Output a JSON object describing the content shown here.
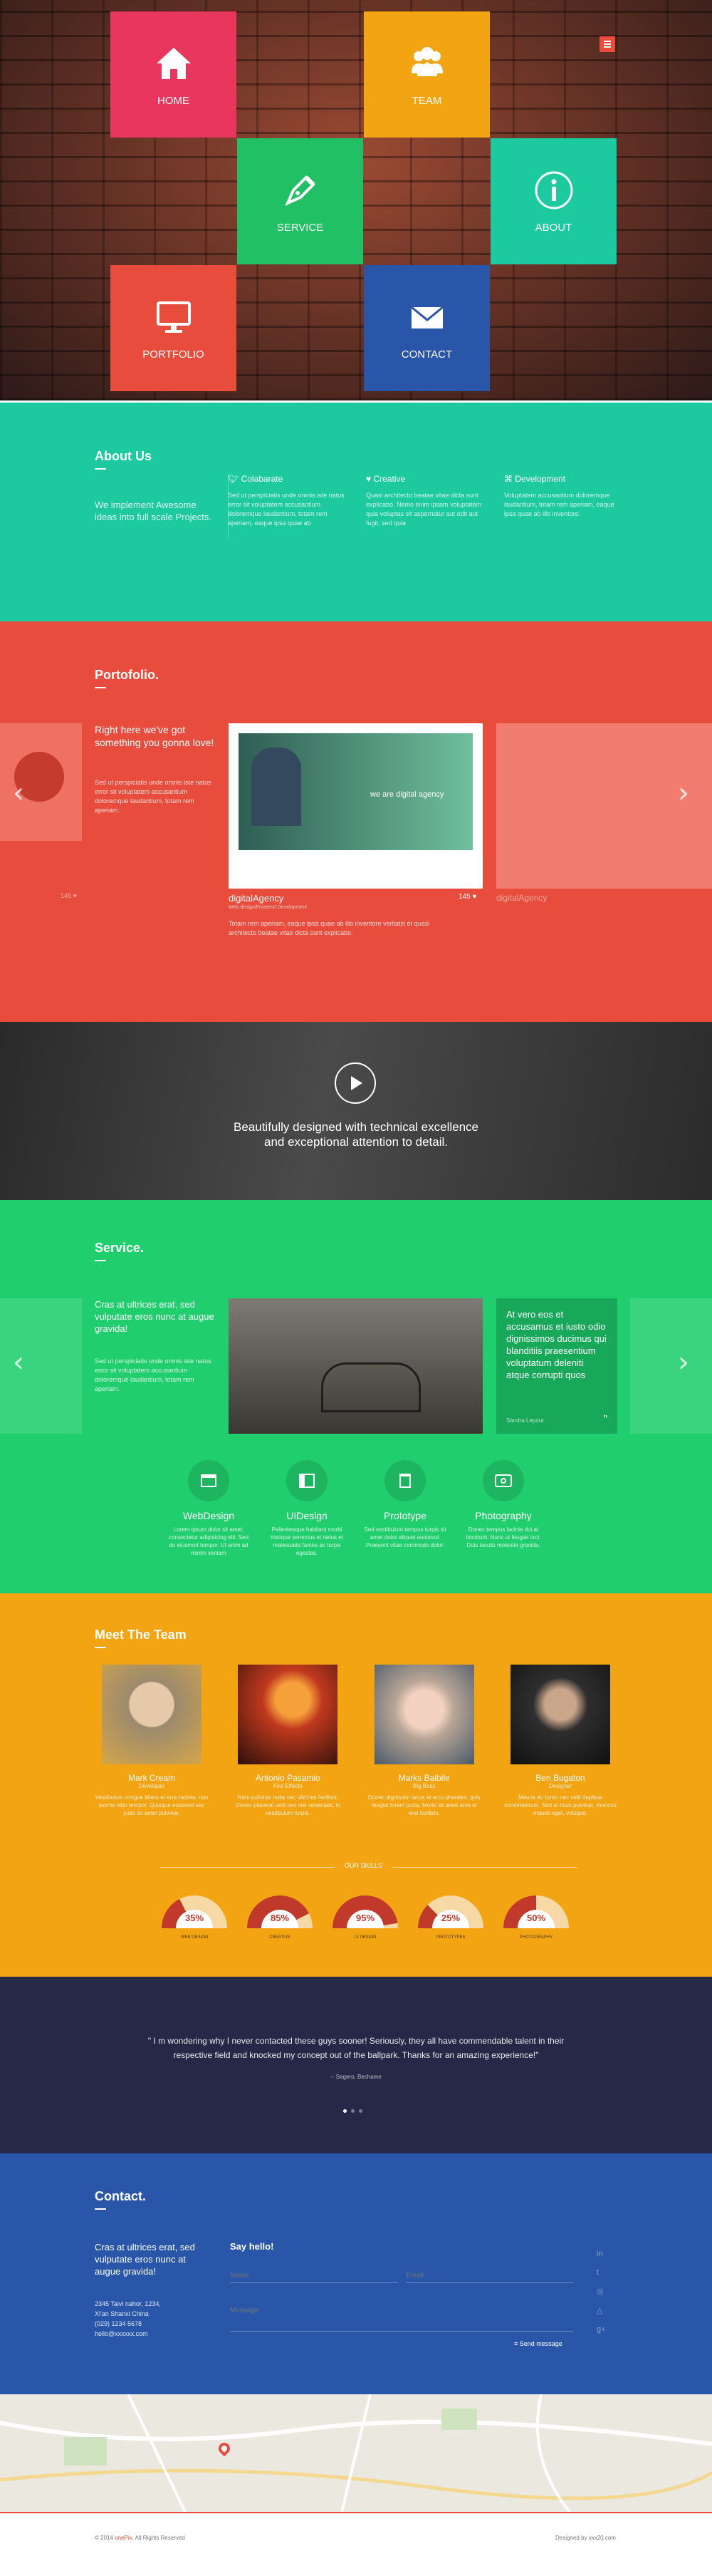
{
  "hero": {
    "tiles": [
      {
        "label": "HOME",
        "color": "#e8365c",
        "icon": "home-icon"
      },
      {
        "label": "TEAM",
        "color": "#f2a413",
        "icon": "team-icon"
      },
      {
        "label": "SERVICE",
        "color": "#21c064",
        "icon": "pen-icon"
      },
      {
        "label": "ABOUT",
        "color": "#1dcaa0",
        "icon": "info-icon"
      },
      {
        "label": "PORTFOLIO",
        "color": "#e74c3c",
        "icon": "monitor-icon"
      },
      {
        "label": "CONTACT",
        "color": "#2956a8",
        "icon": "mail-icon"
      }
    ]
  },
  "about": {
    "title": "About Us",
    "lead": "We implement Awesome ideas into full scale Projects.",
    "cols": [
      {
        "title": "Colabarate",
        "text": "Sed ut perspiciatis unde omnis iste natus error sit voluptatem accusantium doloremque laudantium, totam rem aperiam, eaque ipsa quae ab"
      },
      {
        "title": "Creative",
        "text": "Quasi architecto beatae vitae dicta sunt explicabo. Nemo enim ipsam voluptatem quia voluptas sit aspernatur aut odit aut fugit, sed quia"
      },
      {
        "title": "Development",
        "text": "Voluptatem accusantium doloremque laudantium, totam rem aperiam, eaque ipsa quae ab illo inventore."
      }
    ]
  },
  "portfolio": {
    "title": "Portofolio.",
    "intro": "Right here we've got something you gonna love!",
    "intro_text": "Sed ut perspiciatis unde omnis iste natus error sit voluptatem accusantium doloremque laudantium, totam rem aperiam.",
    "item": {
      "name": "digitalAgency",
      "category": "Web design/Frontend Development",
      "likes": "145",
      "desc": "Totam rem aperiam, eaque ipsa quae ab illo inventore veritatis et quasi architecto beatae vitae dicta sunt explicabo.",
      "screen_text": "we are digital agency"
    },
    "left_likes": "145",
    "right_name": "digitalAgency"
  },
  "video": {
    "line1": "Beautifully designed with technical excellence",
    "line2": "and exceptional attention to detail."
  },
  "service": {
    "title": "Service.",
    "intro": "Cras at ultrices erat, sed vulputate eros nunc at augue gravida!",
    "intro_text": "Sed ut perspiciatis unde omnis iste natus error sit voluptatem accusantium doloremque laudantium, totam rem aperiam.",
    "quote": "At vero eos et accusamus et iusto odio dignissimos ducimus qui blanditiis praesentium voluptatum deleniti atque corrupti quos",
    "quote_author": "Sandra Lepout",
    "items": [
      {
        "title": "WebDesign",
        "text": "Lorem ipsum dolor sit amet, consectetur adipisicing elit. Sed do eiusmod tempor. Ut enim ad minim veniam",
        "icon": "browser-icon"
      },
      {
        "title": "UIDesign",
        "text": "Pellentesque habitant morbi tristique senectus et netus et malesuada fames ac turpis egestas.",
        "icon": "layout-icon"
      },
      {
        "title": "Prototype",
        "text": "Sed vestibulum tempus turpis sit amet dolor aliquet euismod. Praesent vitae commodo dolor.",
        "icon": "trash-icon"
      },
      {
        "title": "Photography",
        "text": "Donec tempus lacinia dui at tincidunt. Nunc ut feugiat orci. Duis iaculis molestie gravida.",
        "icon": "camera-icon"
      }
    ]
  },
  "team": {
    "title": "Meet The Team",
    "skills_title": "OUR SKILLS",
    "members": [
      {
        "name": "Mark Cream",
        "role": "Developer",
        "bio": "Vestibulum congue libero et arcu lacinia, non lacinia nibh tempor. Quisque euismod nec justo sit amet pulvinar.",
        "photo": "#9c8a6e"
      },
      {
        "name": "Antonio Pasamio",
        "role": "Fire Effects",
        "bio": "Nam pulvinar nulla nec ultricies facilisis. Donec placerat velit nec nisi venenatis, in vestibulum turpis.",
        "photo": "#7a2b1d"
      },
      {
        "name": "Marks Balbile",
        "role": "Big Boss",
        "bio": "Donec dignissim lacus at arcu pharetra, quis feugiat lorem porta. Morbi sit amet ante id erat facilisis.",
        "photo": "#b8a596"
      },
      {
        "name": "Ben Bugaton",
        "role": "Designer",
        "bio": "Mauris eu tortor nec velit dapibus condimentum. Sed at risus pulvinar, rhoncus mauris eget, volutpat.",
        "photo": "#2e2e2e"
      }
    ],
    "skills": [
      {
        "label": "WEB DESIGN",
        "value": 35
      },
      {
        "label": "CREATIVE",
        "value": 85
      },
      {
        "label": "UI DESIGN",
        "value": 95
      },
      {
        "label": "PROTOTYPES",
        "value": 25
      },
      {
        "label": "PHOTOGRAPHY",
        "value": 50
      }
    ]
  },
  "testimonial": {
    "quote": "\" I m wondering why I never contacted these guys sooner! Seriously, they all have commendable talent in their respective field and knocked my concept out of the ballpark. Thanks for an amazing experience!\"",
    "author": "-- Segero, Bechame"
  },
  "contact": {
    "title": "Contact.",
    "lead": "Cras at ultrices erat, sed vulputate eros nunc at augue gravida!",
    "address": [
      "2345 Taivi nahor, 1234,",
      "Xi'an Shanxi China",
      "(029) 1234 5678",
      "hello@xxxxxx.com"
    ],
    "form_title": "Say hello!",
    "name_ph": "Name",
    "email_ph": "Email",
    "message_ph": "Message",
    "send": "Send message"
  },
  "footer": {
    "left_prefix": "© 2014 ",
    "brand": "onePix",
    "left_suffix": ". All Rights Reserved",
    "right": "Designed by xxx20.com"
  },
  "colors": {
    "accent": "#e74c3c"
  }
}
